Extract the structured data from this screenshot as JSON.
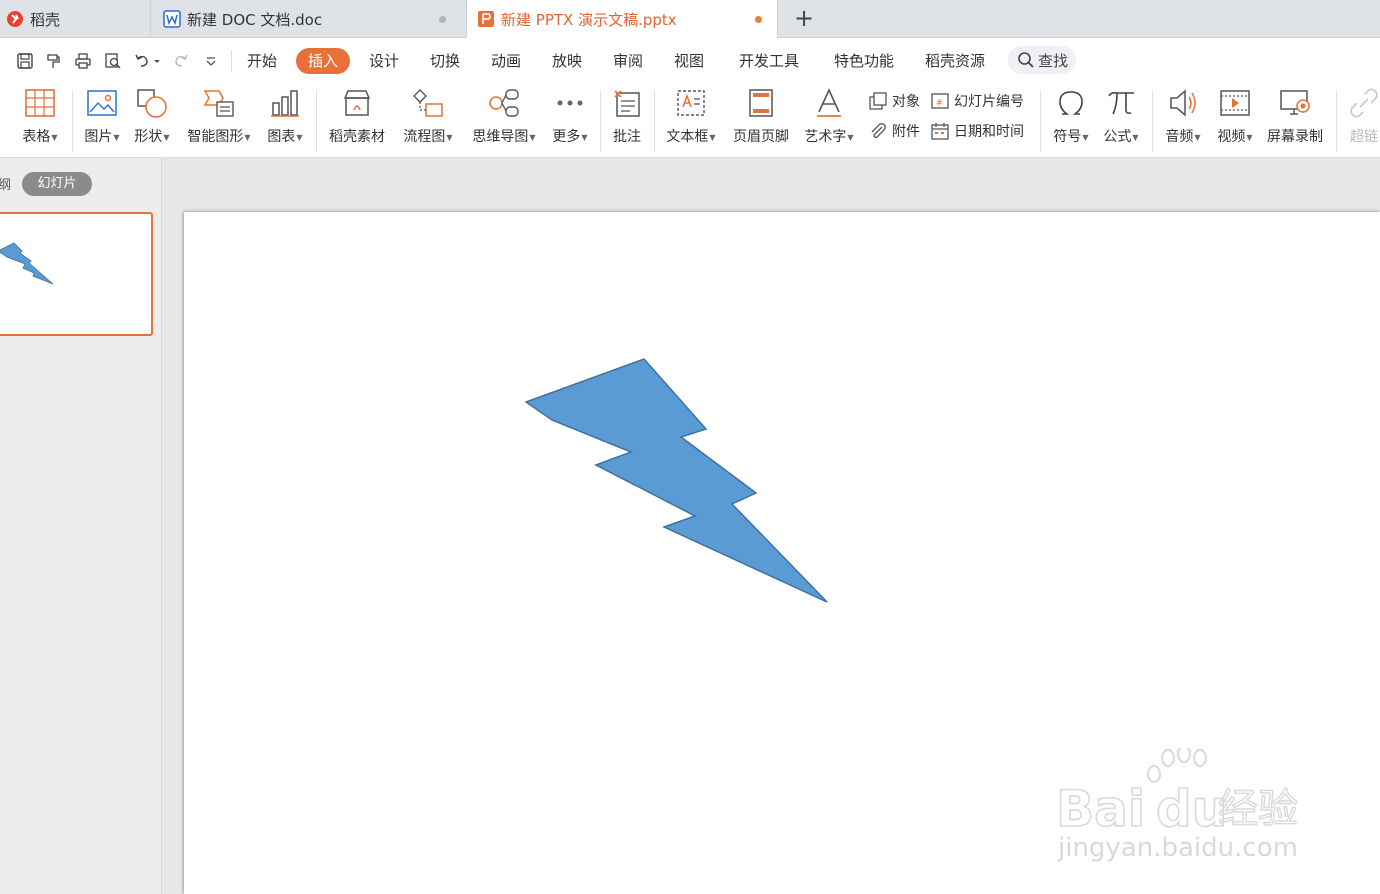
{
  "tabs": [
    {
      "label": "稻壳",
      "icon": "docer-logo-icon"
    },
    {
      "label": "新建 DOC 文档.doc",
      "icon": "word-doc-icon"
    },
    {
      "label": "新建 PPTX 演示文稿.pptx",
      "icon": "ppt-doc-icon"
    }
  ],
  "quick_access": [
    "save-icon",
    "format-painter-icon",
    "print-icon",
    "print-preview-icon",
    "undo-icon",
    "redo-icon",
    "customize-dropdown-icon"
  ],
  "menu": {
    "items": [
      "开始",
      "插入",
      "设计",
      "切换",
      "动画",
      "放映",
      "审阅",
      "视图",
      "开发工具",
      "特色功能",
      "稻壳资源"
    ],
    "active": "插入",
    "search_label": "查找"
  },
  "ribbon": {
    "table": "表格",
    "picture": "图片",
    "shape": "形状",
    "smartart": "智能图形",
    "chart": "图表",
    "docer_material": "稻壳素材",
    "flowchart": "流程图",
    "mindmap": "思维导图",
    "more": "更多",
    "comment": "批注",
    "textbox": "文本框",
    "header_footer": "页眉页脚",
    "wordart": "艺术字",
    "object": "对象",
    "slide_number": "幻灯片编号",
    "attachment": "附件",
    "date_time": "日期和时间",
    "symbol": "符号",
    "formula": "公式",
    "audio": "音频",
    "video": "视频",
    "screen_record": "屏幕录制",
    "hyperlink": "超链"
  },
  "left_panel": {
    "outline_tab": "纲",
    "slides_tab": "幻灯片"
  },
  "slide": {
    "shape_fill": "#5b9bd5",
    "shape_stroke": "#41719c",
    "shape": "lightning-bolt"
  },
  "accent_color": "#e8703a",
  "watermark": {
    "logo": "Bai du 经验",
    "url": "jingyan.baidu.com"
  }
}
